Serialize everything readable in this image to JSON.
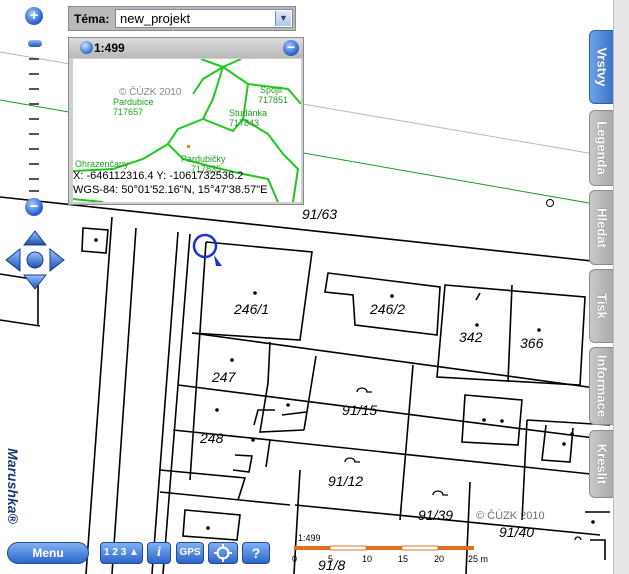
{
  "theme": {
    "label": "Téma:",
    "selected": "new_projekt"
  },
  "overview": {
    "scale": "1:499",
    "copyright": "© ČÚZK 2010",
    "places": [
      {
        "name": "Pardubice",
        "code": "717657"
      },
      {
        "name": "Spojil",
        "code": "717851"
      },
      {
        "name": "Studánka",
        "code": "717843"
      },
      {
        "name": "Pardubičky",
        "code": "717835"
      },
      {
        "name": "Ohrazenčany",
        "code": ""
      }
    ],
    "coords_xy": "X: -646112316.4 Y: -1061732536.2",
    "coords_wgs": "WGS-84: 50°01'52.16\"N, 15°47'38.57\"E"
  },
  "tabs": [
    "Vrstvy",
    "Legenda",
    "Hledat",
    "Tisk",
    "Informace",
    "Kreslit"
  ],
  "map": {
    "parcels": [
      "91/63",
      "246/1",
      "246/2",
      "342",
      "366",
      "247",
      "91/15",
      "248",
      "91/12",
      "91/39",
      "91/40",
      "91/8"
    ],
    "copyright": "© ČÚZK 2010"
  },
  "zoom": {
    "in": "+",
    "out": "−"
  },
  "toolbar": {
    "menu": "Menu",
    "numbering": "1 2 3",
    "info": "i",
    "gps": "GPS",
    "help": "?"
  },
  "brand": "Marushka®",
  "scalebar": {
    "ratio": "1:499",
    "ticks": [
      "0",
      "5",
      "10",
      "15",
      "20",
      "25 m"
    ]
  }
}
